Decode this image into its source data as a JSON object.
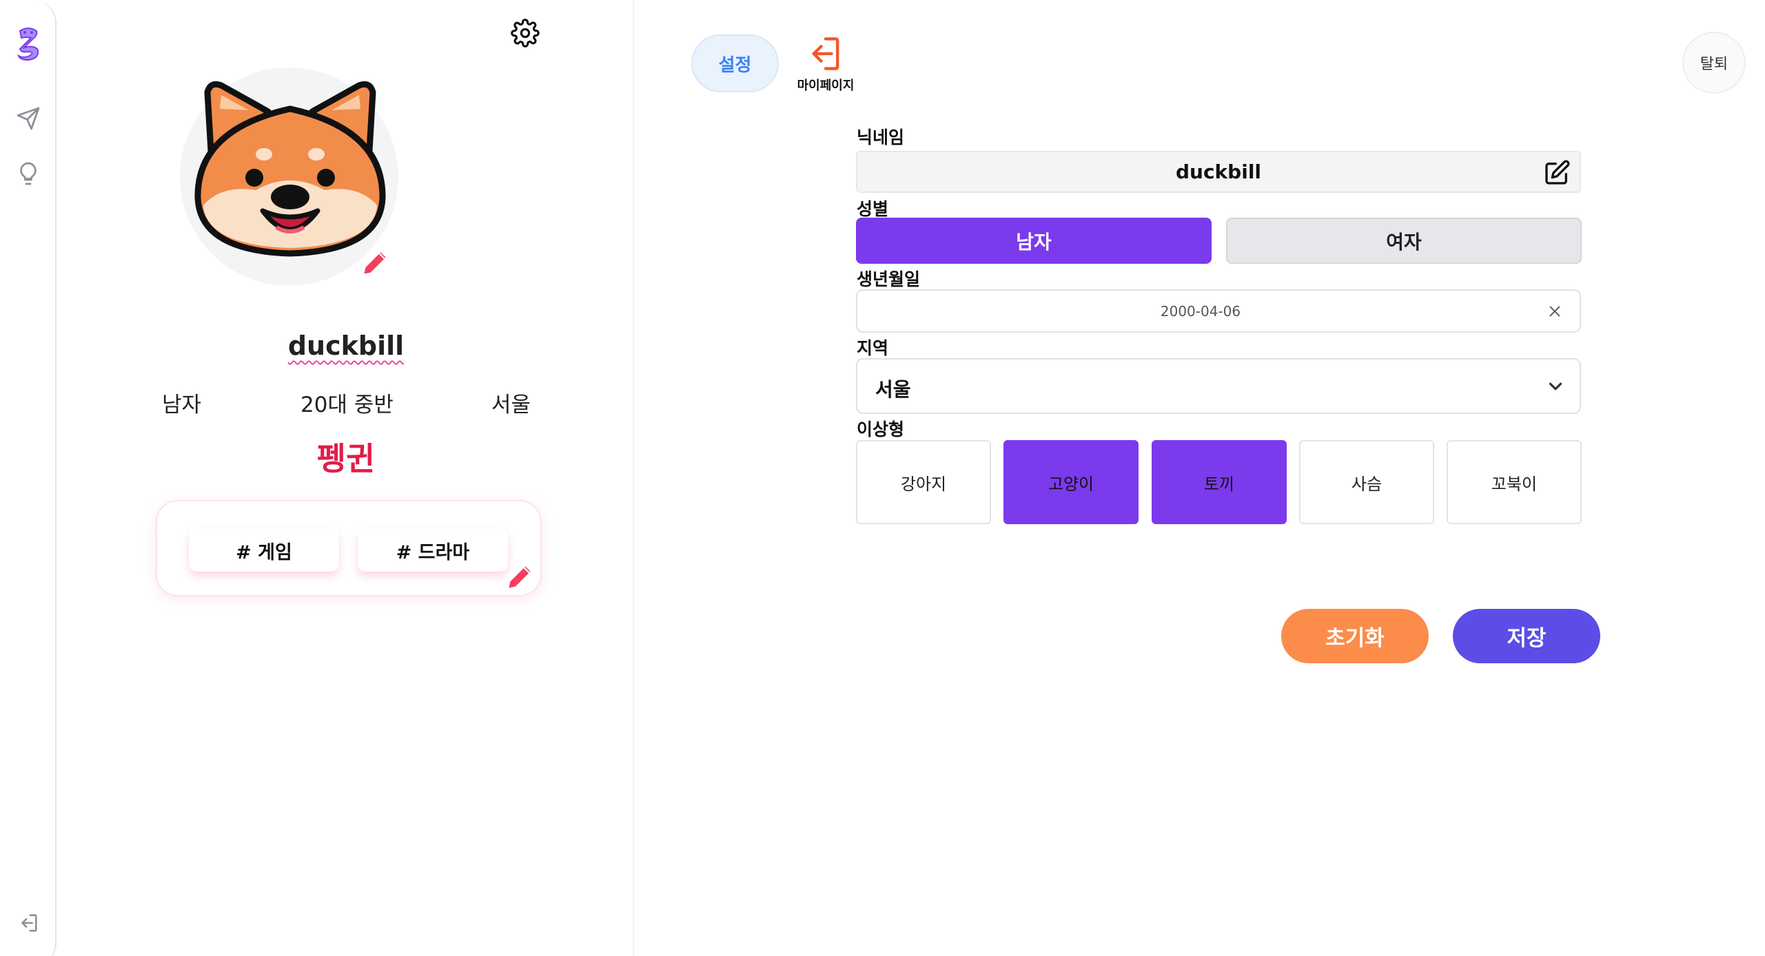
{
  "rail": {
    "icons": [
      "logo-icon",
      "send-icon",
      "lightbulb-icon",
      "logout-icon"
    ]
  },
  "profile": {
    "nickname": "duckbill",
    "gender": "남자",
    "age_group": "20대 중반",
    "region": "서울",
    "ideal_type": "펭귄",
    "tags": [
      "# 게임",
      "# 드라마"
    ]
  },
  "tabs": {
    "settings_label": "설정",
    "mypage_label": "마이페이지"
  },
  "withdraw_label": "탈퇴",
  "form": {
    "nickname_label": "닉네임",
    "nickname_value": "duckbill",
    "gender_label": "성별",
    "gender_options": [
      "남자",
      "여자"
    ],
    "gender_selected": "남자",
    "birth_label": "생년월일",
    "birth_value": "2000-04-06",
    "region_label": "지역",
    "region_value": "서울",
    "ideal_label": "이상형",
    "ideal_options": [
      "강아지",
      "고양이",
      "토끼",
      "사슴",
      "꼬북이"
    ],
    "ideal_selected": [
      "고양이",
      "토끼"
    ],
    "reset_label": "초기화",
    "save_label": "저장"
  },
  "colors": {
    "accent_purple": "#7c3aed",
    "reset_orange": "#fb8c4a",
    "save_indigo": "#5b4de6",
    "ideal_text": "#e11d48",
    "settings_tab_blue": "#3b82f6"
  }
}
